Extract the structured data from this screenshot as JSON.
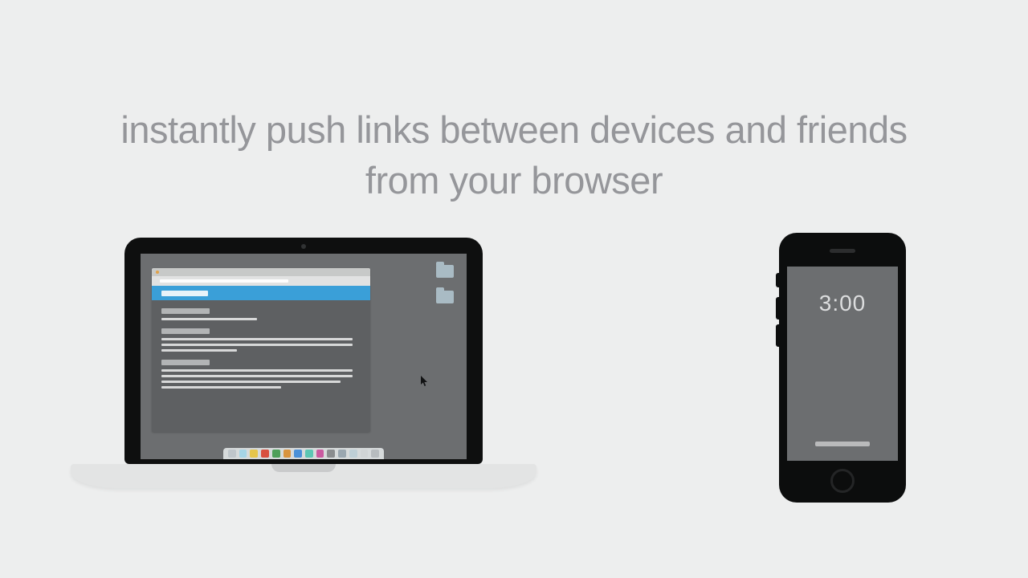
{
  "headline": {
    "line1": "instantly push links between devices and friends",
    "line2": "from your browser"
  },
  "phone": {
    "time": "3:00"
  },
  "dock_colors": [
    "#bfc6cb",
    "#a5d4e5",
    "#e5c54a",
    "#d8503f",
    "#4ea05a",
    "#d8943f",
    "#4a90d8",
    "#5cc6b3",
    "#c95aa0",
    "#8a8d8f",
    "#9aa7b0",
    "#becfd6",
    "#d0d4d5",
    "#b7bcbf"
  ]
}
